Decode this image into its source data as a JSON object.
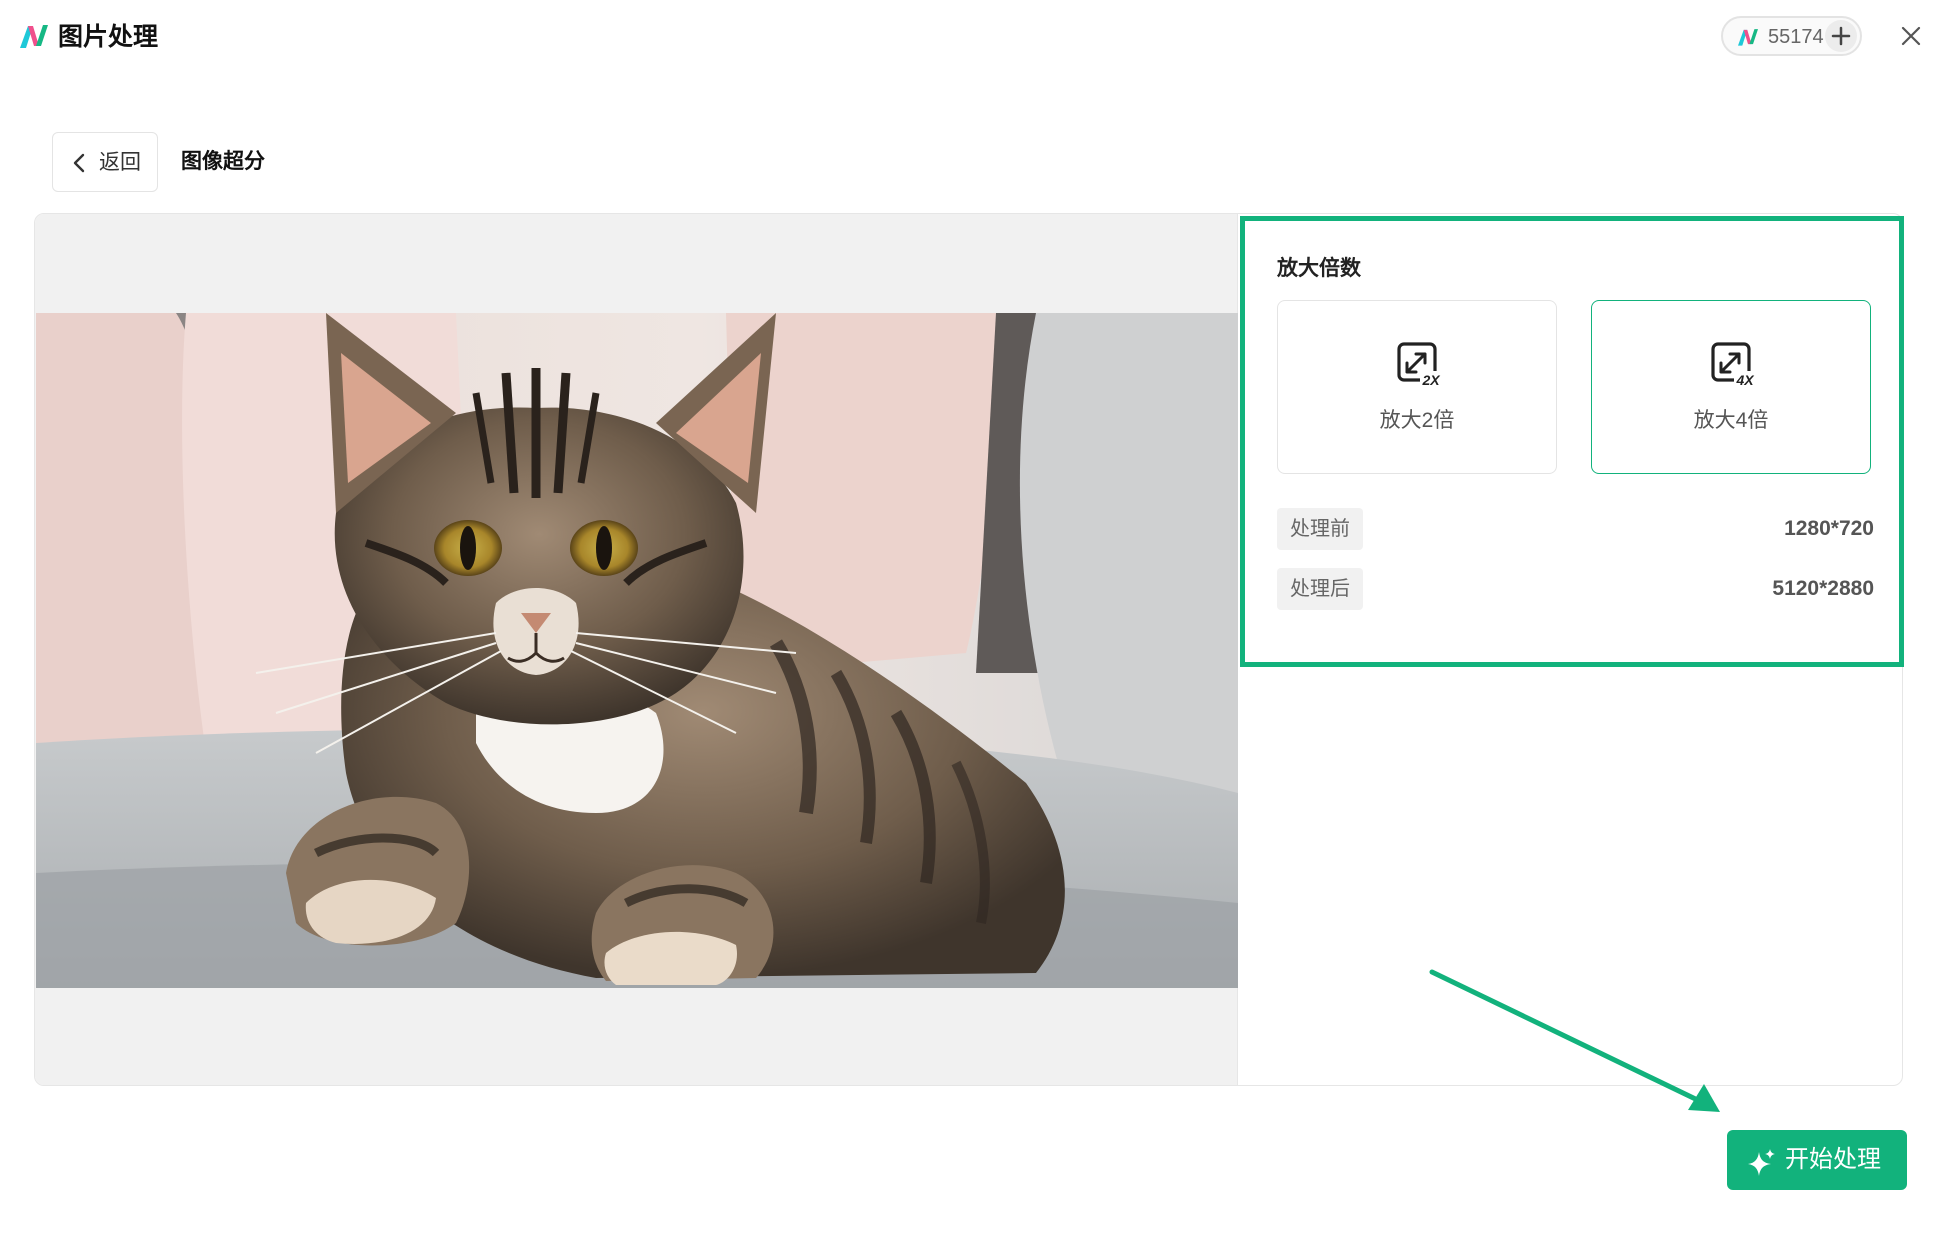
{
  "app": {
    "title": "图片处理",
    "logo_icon": "app-logo-icon",
    "credits": "55174",
    "credits_add_icon": "plus-icon",
    "close_icon": "close-icon"
  },
  "nav": {
    "back_label": "返回",
    "back_icon": "chevron-left-icon",
    "page_title": "图像超分"
  },
  "preview": {
    "image": "tabby-cat-on-sofa-photo"
  },
  "settings": {
    "title": "放大倍数",
    "options": [
      {
        "label": "放大2倍",
        "badge": "2X",
        "icon": "expand-2x-icon",
        "selected": false
      },
      {
        "label": "放大4倍",
        "badge": "4X",
        "icon": "expand-4x-icon",
        "selected": true
      }
    ],
    "before_label": "处理前",
    "before_value": "1280*720",
    "after_label": "处理后",
    "after_value": "5120*2880"
  },
  "actions": {
    "start_label": "开始处理",
    "start_icon": "sparkle-icon"
  },
  "colors": {
    "accent": "#12b27c",
    "logo_pink": "#f0508c",
    "logo_cyan": "#1ec8d8",
    "logo_green": "#16b884"
  }
}
